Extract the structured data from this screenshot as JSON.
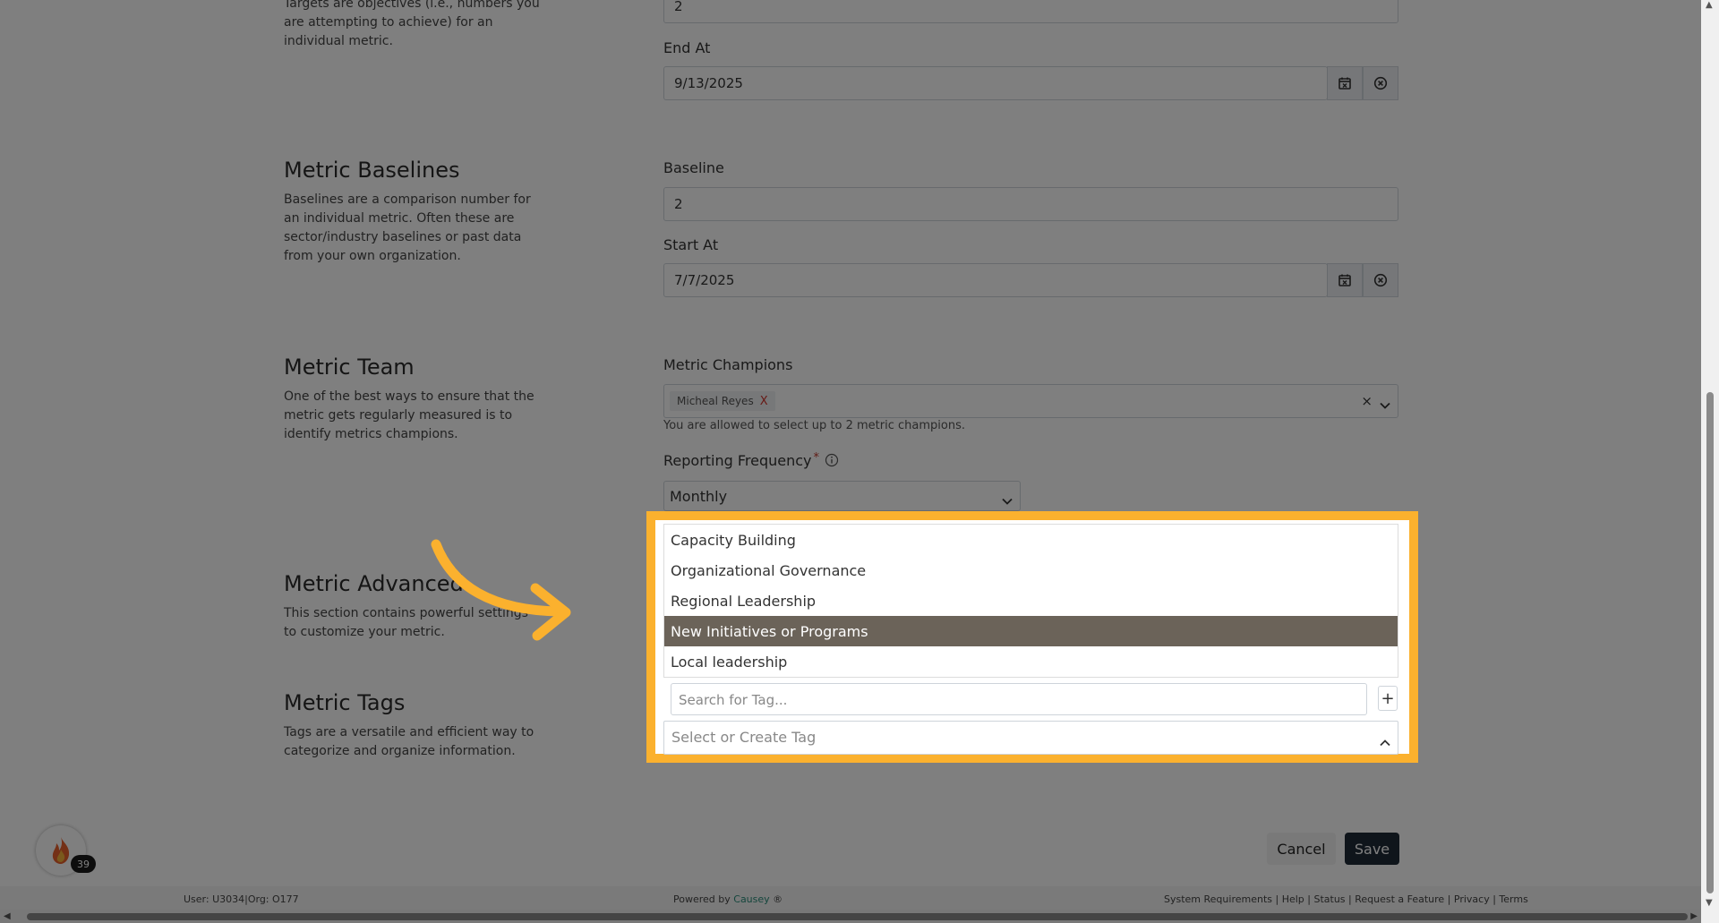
{
  "targets": {
    "description": "Targets are objectives (i.e., numbers you are attempting to achieve) for an individual metric.",
    "target_value": "2",
    "end_at_label": "End At",
    "end_at_value": "9/13/2025"
  },
  "baselines": {
    "title": "Metric Baselines",
    "description": "Baselines are a comparison number for an individual metric. Often these are sector/industry baselines or past data from your own organization.",
    "baseline_label": "Baseline",
    "baseline_value": "2",
    "start_at_label": "Start At",
    "start_at_value": "7/7/2025"
  },
  "team": {
    "title": "Metric Team",
    "description": "One of the best ways to ensure that the metric gets regularly measured is to identify metrics champions.",
    "champions_label": "Metric Champions",
    "champion_chip": "Micheal Reyes",
    "chip_remove": "X",
    "clear_symbol": "×",
    "champions_help": "You are allowed to select up to 2 metric champions.",
    "frequency_label": "Reporting Frequency",
    "required_mark": "*",
    "frequency_value": "Monthly"
  },
  "advanced": {
    "title": "Metric Advanced",
    "description": "This section contains powerful settings to customize your metric."
  },
  "tags": {
    "title": "Metric Tags",
    "description": "Tags are a versatile and efficient way to categorize and organize information.",
    "options": [
      "Capacity Building",
      "Organizational Governance",
      "Regional Leadership",
      "New Initiatives or Programs",
      "Local leadership"
    ],
    "active_option_index": 3,
    "search_placeholder": "Search for Tag...",
    "add_symbol": "+",
    "select_placeholder": "Select or Create Tag"
  },
  "actions": {
    "cancel": "Cancel",
    "save": "Save"
  },
  "streak": {
    "count": "39",
    "icon": "flame-icon"
  },
  "footer": {
    "user_info": "User: U3034|Org: O177",
    "powered_by": "Powered by",
    "brand": "Causey",
    "brand_mark": "®",
    "links": "System Requirements | Help | Status | Request a Feature | Privacy | Terms"
  },
  "colors": {
    "highlight": "#fbb12e",
    "active_option": "#6b6359",
    "save_button": "#1e2a36",
    "brand": "#2a8d7a"
  }
}
